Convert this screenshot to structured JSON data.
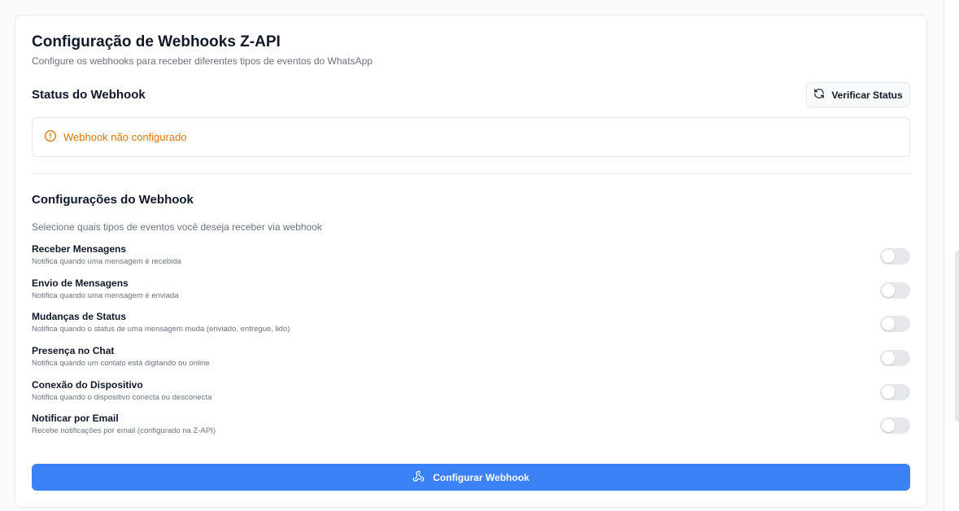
{
  "header": {
    "title": "Configuração de Webhooks Z-API",
    "subtitle": "Configure os webhooks para receber diferentes tipos de eventos do WhatsApp"
  },
  "status": {
    "section_title": "Status do Webhook",
    "verify_button": "Verificar Status",
    "message": "Webhook não configurado",
    "message_color": "#d97706"
  },
  "settings": {
    "section_title": "Configurações do Webhook",
    "help": "Selecione quais tipos de eventos você deseja receber via webhook",
    "options": [
      {
        "label": "Receber Mensagens",
        "description": "Notifica quando uma mensagem é recebida",
        "enabled": false
      },
      {
        "label": "Envio de Mensagens",
        "description": "Notifica quando uma mensagem é enviada",
        "enabled": false
      },
      {
        "label": "Mudanças de Status",
        "description": "Notifica quando o status de uma mensagem muda (enviado, entregue, lido)",
        "enabled": false
      },
      {
        "label": "Presença no Chat",
        "description": "Notifica quando um contato está digitando ou online",
        "enabled": false
      },
      {
        "label": "Conexão do Dispositivo",
        "description": "Notifica quando o dispositivo conecta ou desconecta",
        "enabled": false
      },
      {
        "label": "Notificar por Email",
        "description": "Recebe notificações por email (configurado na Z-API)",
        "enabled": false
      }
    ]
  },
  "cta": {
    "label": "Configurar Webhook",
    "color": "#3b82f6"
  },
  "icons": {
    "refresh": "refresh-icon",
    "alert": "alert-circle-icon",
    "webhook": "webhook-icon"
  }
}
